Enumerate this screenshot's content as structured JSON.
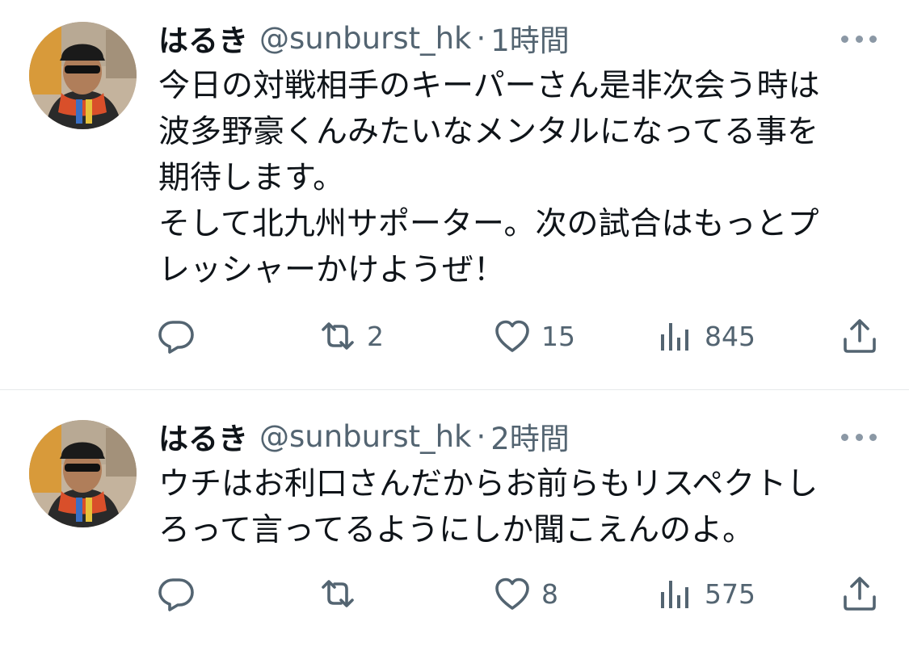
{
  "tweets": [
    {
      "name": "はるき",
      "handle": "@sunburst_hk",
      "separator": "·",
      "time": "1時間",
      "text": "今日の対戦相手のキーパーさん是非次会う時は\n波多野豪くんみたいなメンタルになってる事を\n期待します。\nそして北九州サポーター。次の試合はもっとプ\nレッシャーかけようぜ！",
      "actions": {
        "reply_count": "",
        "retweet_count": "2",
        "like_count": "15",
        "view_count": "845"
      }
    },
    {
      "name": "はるき",
      "handle": "@sunburst_hk",
      "separator": "·",
      "time": "2時間",
      "text": "ウチはお利口さんだからお前らもリスペクトし\nろって言ってるようにしか聞こえんのよ。",
      "actions": {
        "reply_count": "",
        "retweet_count": "",
        "like_count": "8",
        "view_count": "575"
      }
    }
  ],
  "icons": {
    "more": "more-dots-icon",
    "reply": "reply-bubble-icon",
    "retweet": "retweet-arrows-icon",
    "like": "heart-icon",
    "views": "views-bar-chart-icon",
    "share": "share-upload-icon"
  },
  "colors": {
    "text": "#0f1419",
    "secondary": "#536471",
    "divider": "#e6e9eb"
  }
}
